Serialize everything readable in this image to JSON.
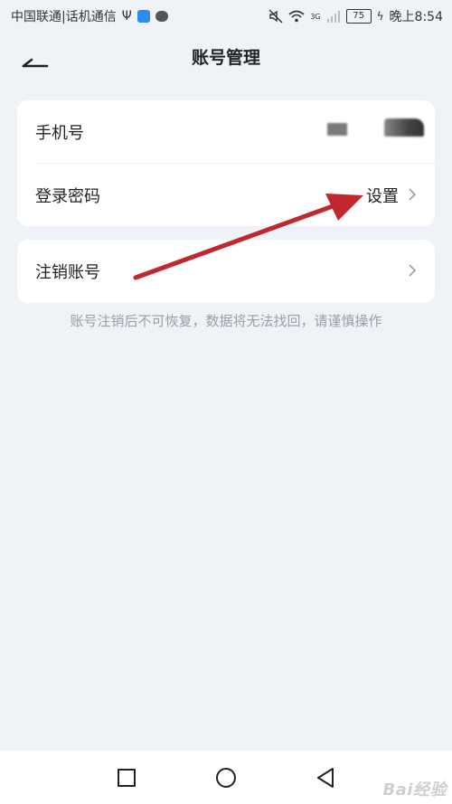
{
  "status_bar": {
    "carrier": "中国联通|话机通信",
    "usb_icon": "usb-icon",
    "battery": "75",
    "time": "晚上8:54",
    "network_label": "3G"
  },
  "header": {
    "title": "账号管理",
    "back_icon": "back-arrow-icon"
  },
  "account_card": {
    "rows": [
      {
        "label": "手机号",
        "value": ""
      },
      {
        "label": "登录密码",
        "value": "设置"
      }
    ]
  },
  "cancel_card": {
    "label": "注销账号"
  },
  "hint": "账号注销后不可恢复，数据将无法找回，请谨慎操作",
  "nav_bar": {
    "buttons": [
      "recent-apps-icon",
      "home-icon",
      "back-icon"
    ]
  },
  "watermark": "Bai经验",
  "colors": {
    "background": "#eff2f7",
    "card": "#ffffff",
    "hint_text": "#9a9ea6",
    "annotation_arrow": "#c1272d"
  }
}
